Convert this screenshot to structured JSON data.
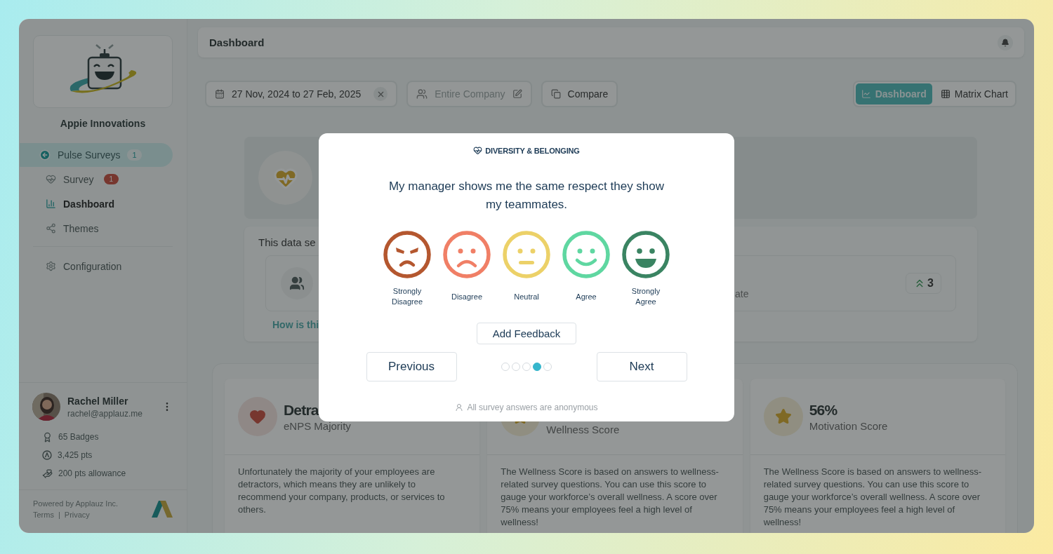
{
  "sidebar": {
    "company_name": "Appie Innovations",
    "back_item": {
      "label": "Pulse Surveys",
      "count": "1"
    },
    "items": [
      {
        "label": "Survey",
        "badge": "1",
        "selected": false
      },
      {
        "label": "Dashboard",
        "selected": true
      },
      {
        "label": "Themes",
        "selected": false
      }
    ],
    "settings_item": {
      "label": "Configuration"
    },
    "user": {
      "name": "Rachel Miller",
      "email": "rachel@applauz.me",
      "stats": [
        "65 Badges",
        "3,425 pts",
        "200 pts allowance"
      ]
    },
    "footer": {
      "powered_by": "Powered by Applauz Inc.",
      "links": [
        "Terms",
        "Privacy"
      ],
      "separator": "|"
    }
  },
  "header": {
    "title": "Dashboard"
  },
  "filters": {
    "date_range": "27 Nov, 2024 to 27 Feb, 2025",
    "audience_placeholder": "Entire Company",
    "compare": "Compare"
  },
  "view_toggle": [
    {
      "label": "Dashboard",
      "selected": true
    },
    {
      "label": "Matrix Chart",
      "selected": false
    }
  ],
  "summary": {
    "data_note": "This data se",
    "stat_text": "ate",
    "trend": "3",
    "link": "How is thi"
  },
  "score_cards": [
    {
      "title": "Detra",
      "subtitle": "eNPS Majority",
      "description": "Unfortunately the majority of your employees are detractors, which means they are unlikely to recommend your company, products, or services to others."
    },
    {
      "subtitle": "Wellness Score",
      "description": "The Wellness Score is based on answers to wellness-related survey questions. You can use this score to gauge your workforce’s overall wellness. A score over 75% means your employees feel a high level of wellness!"
    },
    {
      "title": "56%",
      "subtitle": "Motivation Score",
      "description": "The Wellness Score is based on answers to wellness-related survey questions. You can use this score to gauge your workforce’s overall wellness. A score over 75% means your employees feel a high level of wellness!"
    }
  ],
  "survey_modal": {
    "category": "DIVERSITY & BELONGING",
    "question": "My manager shows me the same respect they show my teammates.",
    "options": [
      {
        "label": "Strongly Disagree",
        "kind": "angry",
        "color": "#b4572f"
      },
      {
        "label": "Disagree",
        "kind": "sad",
        "color": "#f07f66"
      },
      {
        "label": "Neutral",
        "kind": "neutral",
        "color": "#ecd168"
      },
      {
        "label": "Agree",
        "kind": "smile",
        "color": "#5fd7a1"
      },
      {
        "label": "Strongly Agree",
        "kind": "grin",
        "color": "#3a8462"
      }
    ],
    "feedback_button": "Add Feedback",
    "previous": "Previous",
    "next": "Next",
    "steps": [
      {
        "selected": false
      },
      {
        "selected": false
      },
      {
        "selected": false
      },
      {
        "selected": true
      },
      {
        "selected": false
      }
    ],
    "note": "All survey answers are anonymous"
  }
}
